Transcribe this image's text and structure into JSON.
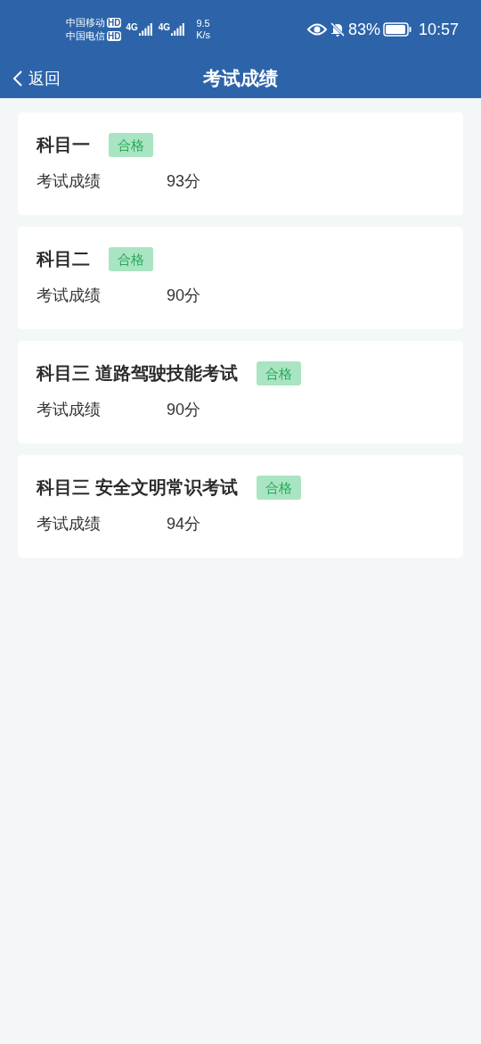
{
  "status_bar": {
    "carriers": [
      {
        "name": "中国移动",
        "badge": "HD"
      },
      {
        "name": "中国电信",
        "badge": "HD"
      }
    ],
    "network": [
      "4G",
      "4G"
    ],
    "speed": "9.5",
    "speed_unit": "K/s",
    "battery": "83%",
    "time": "10:57"
  },
  "nav": {
    "back": "返回",
    "title": "考试成绩"
  },
  "results": [
    {
      "subject": "科目一",
      "badge": "合格",
      "label": "考试成绩",
      "score": "93分"
    },
    {
      "subject": "科目二",
      "badge": "合格",
      "label": "考试成绩",
      "score": "90分"
    },
    {
      "subject": "科目三 道路驾驶技能考试",
      "badge": "合格",
      "label": "考试成绩",
      "score": "90分"
    },
    {
      "subject": "科目三 安全文明常识考试",
      "badge": "合格",
      "label": "考试成绩",
      "score": "94分"
    }
  ]
}
